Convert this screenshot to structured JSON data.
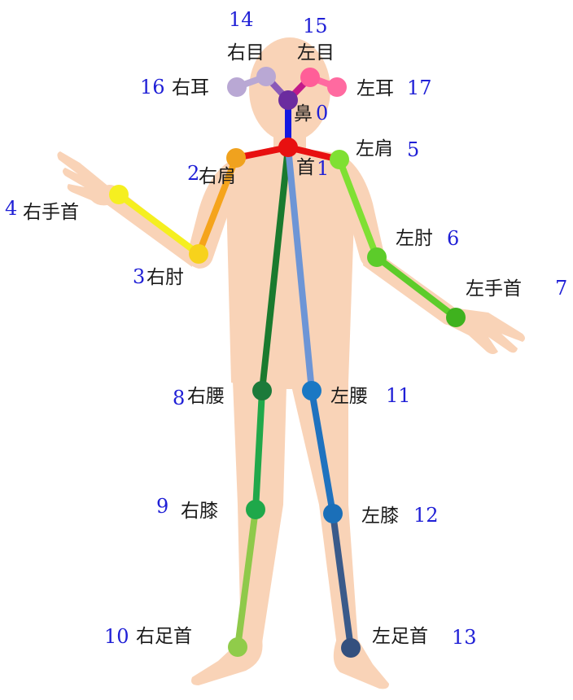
{
  "colors": {
    "body": "#f9d3b7",
    "number": "#1f1fd6",
    "label": "#1a1a1a"
  },
  "keypoints": [
    {
      "id": "0",
      "name": "鼻",
      "color": "#6b2c9f"
    },
    {
      "id": "1",
      "name": "首",
      "color": "#e81010"
    },
    {
      "id": "2",
      "name": "右肩",
      "color": "#f0a21e"
    },
    {
      "id": "3",
      "name": "右肘",
      "color": "#f7d21c"
    },
    {
      "id": "4",
      "name": "右手首",
      "color": "#f5ef20"
    },
    {
      "id": "5",
      "name": "左肩",
      "color": "#7fe033"
    },
    {
      "id": "6",
      "name": "左肘",
      "color": "#5ccc2a"
    },
    {
      "id": "7",
      "name": "左手首",
      "color": "#3fb21e"
    },
    {
      "id": "8",
      "name": "右腰",
      "color": "#1c7a3a"
    },
    {
      "id": "9",
      "name": "右膝",
      "color": "#1fa84a"
    },
    {
      "id": "10",
      "name": "右足首",
      "color": "#90cc4a"
    },
    {
      "id": "11",
      "name": "左腰",
      "color": "#1a78c4"
    },
    {
      "id": "12",
      "name": "左膝",
      "color": "#1b6fb8"
    },
    {
      "id": "13",
      "name": "左足首",
      "color": "#34507e"
    },
    {
      "id": "14",
      "name": "右目",
      "color": "#b9a8d4"
    },
    {
      "id": "15",
      "name": "左目",
      "color": "#ff5e98"
    },
    {
      "id": "16",
      "name": "右耳",
      "color": "#b9a8d4"
    },
    {
      "id": "17",
      "name": "左耳",
      "color": "#ff6aa0"
    }
  ],
  "connections": [
    {
      "from": "0",
      "to": "1",
      "color": "#1418e0"
    },
    {
      "from": "1",
      "to": "2",
      "color": "#e81010"
    },
    {
      "from": "2",
      "to": "3",
      "color": "#f5a41c"
    },
    {
      "from": "3",
      "to": "4",
      "color": "#f5ef20"
    },
    {
      "from": "1",
      "to": "5",
      "color": "#e81010"
    },
    {
      "from": "5",
      "to": "6",
      "color": "#7fe033"
    },
    {
      "from": "6",
      "to": "7",
      "color": "#5ccc2a"
    },
    {
      "from": "1",
      "to": "8",
      "color": "#1a7a2e"
    },
    {
      "from": "8",
      "to": "9",
      "color": "#21a84a"
    },
    {
      "from": "9",
      "to": "10",
      "color": "#8fc94a"
    },
    {
      "from": "1",
      "to": "11",
      "color": "#6d95d6"
    },
    {
      "from": "11",
      "to": "12",
      "color": "#1f72bf"
    },
    {
      "from": "12",
      "to": "13",
      "color": "#3a5a8a"
    },
    {
      "from": "0",
      "to": "14",
      "color": "#8a5ab8"
    },
    {
      "from": "14",
      "to": "16",
      "color": "#b9a8d4"
    },
    {
      "from": "0",
      "to": "15",
      "color": "#c21a8a"
    },
    {
      "from": "15",
      "to": "17",
      "color": "#ff6aa0"
    }
  ]
}
